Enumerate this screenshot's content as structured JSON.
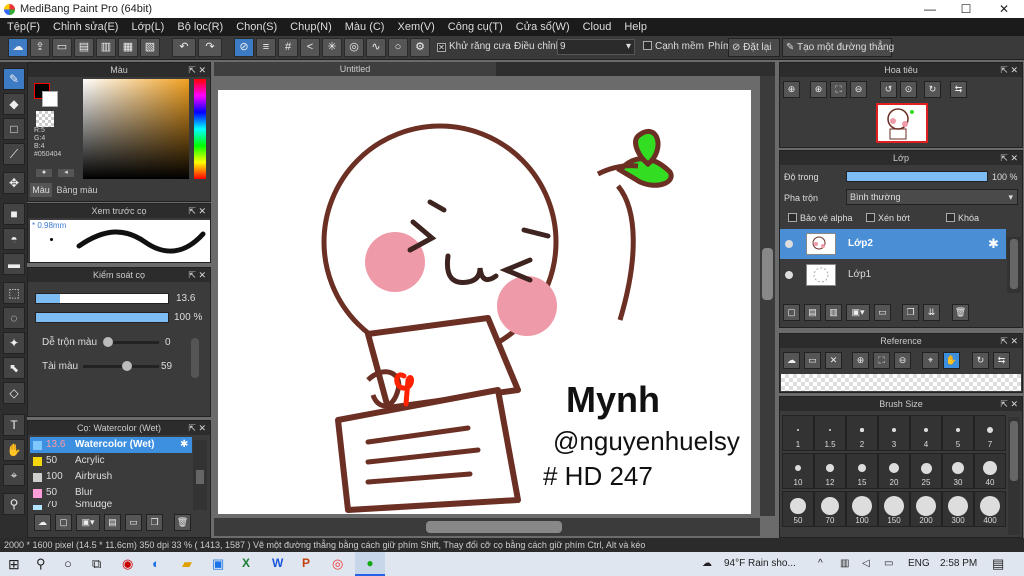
{
  "window": {
    "title": "MediBang Paint Pro (64bit)",
    "min": "—",
    "max": "☐",
    "close": "✕"
  },
  "menu": [
    "Tệp(F)",
    "Chỉnh sửa(E)",
    "Lớp(L)",
    "Bộ lọc(R)",
    "Chọn(S)",
    "Chụp(N)",
    "Màu (C)",
    "Xem(V)",
    "Công cụ(T)",
    "Cửa sổ(W)",
    "Cloud",
    "Help"
  ],
  "toolbar": {
    "antialias": "Khử răng cưa",
    "adjust_label": "Điều chỉnh",
    "adjust_value": "9",
    "smooth": "Cạnh mềm",
    "key_label": "Phím",
    "reset": "Đặt lại",
    "make_line": "Tạo một đường thẳng"
  },
  "color_panel": {
    "title": "Màu",
    "r": "R:5",
    "g": "G:4",
    "b": "B:4",
    "hex": "#050404",
    "tab_color": "Màu",
    "tab_palette": "Bảng màu",
    "fg_color": "#050404"
  },
  "brush_preview": {
    "title": "Xem trước cọ",
    "size": "* 0.98mm"
  },
  "brush_control": {
    "title": "Kiểm soát cọ",
    "size_value": "13.6",
    "opacity_value": "100 %",
    "blend_label": "Dễ trộn màu",
    "blend_value": "0",
    "ink_label": "Tài màu",
    "ink_value": "59",
    "size_fill": 0.18,
    "opacity_fill": 1.0,
    "blend_fill": 0.0,
    "ink_fill": 0.59
  },
  "brush_list": {
    "title": "Cọ: Watercolor (Wet)",
    "items": [
      {
        "size": "13.6",
        "name": "Watercolor (Wet)",
        "color": "#7ec8ff",
        "selected": true
      },
      {
        "size": "50",
        "name": "Acrylic",
        "color": "#f5d60a"
      },
      {
        "size": "100",
        "name": "Airbrush",
        "color": "#cfcfcf"
      },
      {
        "size": "50",
        "name": "Blur",
        "color": "#ff9ed8"
      },
      {
        "size": "70",
        "name": "Smudge",
        "color": "#b3e3ff"
      }
    ]
  },
  "canvas": {
    "tab": "Untitled",
    "signature_name": "Mynh",
    "signature_handle": "@nguyenhuelsy",
    "signature_tag": "# HD 247",
    "sprout_color": "#33dd22",
    "outline_color": "#6b2f24",
    "cheek_color": "#ef9aa8",
    "accent_red": "#ff2200"
  },
  "navigator": {
    "title": "Hoa tiêu"
  },
  "layers": {
    "title": "Lớp",
    "opacity_label": "Độ trong",
    "opacity_value": "100 %",
    "blend_label": "Pha trộn",
    "blend_value": "Bình thường",
    "protect_alpha": "Bảo vệ alpha",
    "clip": "Xén bớt",
    "lock": "Khóa",
    "items": [
      {
        "name": "Lớp2",
        "selected": true
      },
      {
        "name": "Lớp1",
        "selected": false
      }
    ]
  },
  "reference": {
    "title": "Reference"
  },
  "brush_size": {
    "title": "Brush Size",
    "values": [
      "1",
      "1.5",
      "2",
      "3",
      "4",
      "5",
      "7",
      "10",
      "12",
      "15",
      "20",
      "25",
      "30",
      "40",
      "50",
      "70",
      "100",
      "150",
      "200",
      "300",
      "400"
    ]
  },
  "status": "2000 * 1600 pixel   (14.5 * 11.6cm)   350 dpi   33 %   ( 1413, 1587 )   Vẽ một đường thẳng bằng cách giữ phím Shift, Thay đổi cỡ cọ bằng cách giữ phím Ctrl, Alt và kéo",
  "taskbar": {
    "weather": "94°F  Rain sho...",
    "lang": "ENG",
    "time": "2:58 PM"
  }
}
